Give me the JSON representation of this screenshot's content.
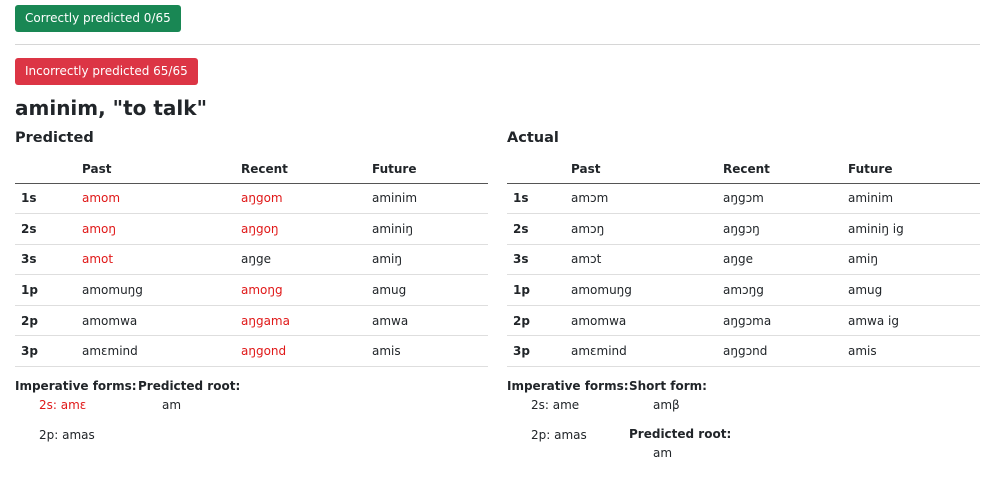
{
  "summary": {
    "correct_label": "Correctly predicted 0/65",
    "incorrect_label": "Incorrectly predicted 65/65"
  },
  "word": {
    "title": "aminim, \"to talk\""
  },
  "predicted": {
    "title": "Predicted",
    "columns": [
      "",
      "Past",
      "Recent",
      "Future"
    ],
    "rows": [
      {
        "label": "1s",
        "past": "amom",
        "recent": "aŋgom",
        "future": "aminim",
        "wrong": [
          true,
          true,
          false
        ]
      },
      {
        "label": "2s",
        "past": "amoŋ",
        "recent": "aŋgoŋ",
        "future": "aminiŋ",
        "wrong": [
          true,
          true,
          false
        ]
      },
      {
        "label": "3s",
        "past": "amot",
        "recent": "aŋge",
        "future": "amiŋ",
        "wrong": [
          true,
          false,
          false
        ]
      },
      {
        "label": "1p",
        "past": "amomuŋg",
        "recent": "amoŋg",
        "future": "amug",
        "wrong": [
          false,
          true,
          false
        ]
      },
      {
        "label": "2p",
        "past": "amomwa",
        "recent": "aŋgama",
        "future": "amwa",
        "wrong": [
          false,
          true,
          false
        ]
      },
      {
        "label": "3p",
        "past": "amɛmind",
        "recent": "aŋgond",
        "future": "amis",
        "wrong": [
          false,
          true,
          false
        ]
      }
    ],
    "imperative_heading": "Imperative forms:",
    "imperative_2s": "2s: amɛ",
    "imperative_2p": "2p: amas",
    "root_heading": "Predicted root:",
    "root_value": "am"
  },
  "actual": {
    "title": "Actual",
    "columns": [
      "",
      "Past",
      "Recent",
      "Future"
    ],
    "rows": [
      {
        "label": "1s",
        "past": "amɔm",
        "recent": "aŋgɔm",
        "future": "aminim"
      },
      {
        "label": "2s",
        "past": "amɔŋ",
        "recent": "aŋgɔŋ",
        "future": "aminiŋ ig"
      },
      {
        "label": "3s",
        "past": "amɔt",
        "recent": "aŋge",
        "future": "amiŋ"
      },
      {
        "label": "1p",
        "past": "amomuŋg",
        "recent": "amɔŋg",
        "future": "amug"
      },
      {
        "label": "2p",
        "past": "amomwa",
        "recent": "aŋgɔma",
        "future": "amwa ig"
      },
      {
        "label": "3p",
        "past": "amɛmind",
        "recent": "aŋgɔnd",
        "future": "amis"
      }
    ],
    "imperative_heading": "Imperative forms:",
    "imperative_2s": "2s: ame",
    "imperative_2p": "2p: amas",
    "short_heading": "Short form:",
    "short_value": "amβ",
    "root_heading": "Predicted root:",
    "root_value": "am"
  },
  "colors": {
    "success": "#198754",
    "danger": "#dc3545",
    "wrong_text": "#e01818"
  }
}
